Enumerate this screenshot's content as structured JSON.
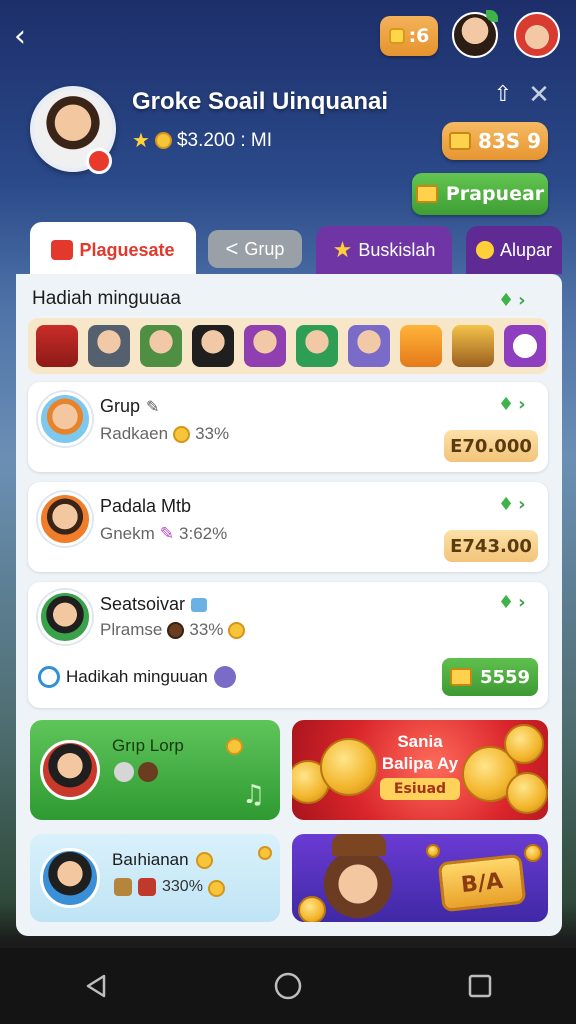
{
  "header": {
    "token_count": ":6",
    "profile_name": "Groke Soail Uinquanai",
    "profile_stat": "$3.200 : MI",
    "balance": "83S 9",
    "action_button": "Prapuear"
  },
  "tabs": [
    {
      "label": "Plaguesate"
    },
    {
      "label": "Grup"
    },
    {
      "label": "Buskislah"
    },
    {
      "label": "Alupar"
    }
  ],
  "rewards": {
    "title": "Hadiah minguuaa",
    "item_count": 10
  },
  "cards": [
    {
      "title": "Grup",
      "sub_label": "Radkaen",
      "stat": "33%",
      "amount": "E70.000"
    },
    {
      "title": "Padala Mtb",
      "sub_label": "Gnekm",
      "stat": "3:62%",
      "amount": "E743.00"
    },
    {
      "title": "Seatsoivar",
      "sub_label": "Plramse",
      "stat": "33%",
      "footer": "Hadikah minguuan",
      "amount": "5559"
    }
  ],
  "promos": [
    {
      "title": "Grıp Lorp"
    },
    {
      "title_line1": "Sania",
      "title_line2": "Balipa Ay",
      "button": "Esiuad"
    },
    {
      "title": "Baıhianan",
      "stat": "330%"
    },
    {
      "badge": "B/A"
    }
  ],
  "colors": {
    "accent_red": "#e3382c",
    "accent_green": "#3f9e34",
    "accent_orange": "#e79532",
    "accent_purple": "#6f35a5"
  }
}
